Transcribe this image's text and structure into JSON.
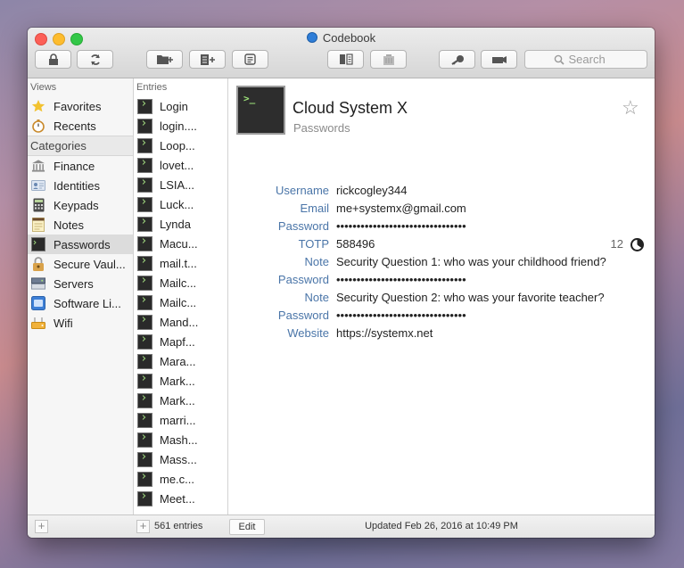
{
  "window": {
    "title": "Codebook"
  },
  "toolbar": {
    "buttons": [
      "lock-icon",
      "sync-icon",
      "add-folder-icon",
      "add-entry-icon",
      "note-icon",
      "split-view-icon",
      "trash-icon",
      "key-icon",
      "camera-icon"
    ],
    "search_placeholder": "Search"
  },
  "sidebar": {
    "views_header": "Views",
    "views": [
      {
        "label": "Favorites",
        "icon": "star-icon"
      },
      {
        "label": "Recents",
        "icon": "stopwatch-icon"
      }
    ],
    "categories_header": "Categories",
    "categories": [
      {
        "label": "Finance",
        "icon": "bank-icon"
      },
      {
        "label": "Identities",
        "icon": "id-card-icon"
      },
      {
        "label": "Keypads",
        "icon": "calculator-icon"
      },
      {
        "label": "Notes",
        "icon": "notepad-icon"
      },
      {
        "label": "Passwords",
        "icon": "terminal-icon",
        "selected": true
      },
      {
        "label": "Secure Vaul...",
        "icon": "padlock-icon"
      },
      {
        "label": "Servers",
        "icon": "server-icon"
      },
      {
        "label": "Software Li...",
        "icon": "software-icon"
      },
      {
        "label": "Wifi",
        "icon": "wifi-router-icon"
      }
    ]
  },
  "entries": {
    "header": "Entries",
    "items": [
      "Login",
      "login....",
      "Loop...",
      "lovet...",
      "LSIA...",
      "Luck...",
      "Lynda",
      "Macu...",
      "mail.t...",
      "Mailc...",
      "Mailc...",
      "Mand...",
      "Mapf...",
      "Mara...",
      "Mark...",
      "Mark...",
      "marri...",
      "Mash...",
      "Mass...",
      "me.c...",
      "Meet..."
    ]
  },
  "detail": {
    "title": "Cloud System X",
    "category": "Passwords",
    "icon": "terminal-icon",
    "fields": [
      {
        "label": "Username",
        "value": "rickcogley344"
      },
      {
        "label": "Email",
        "value": "me+systemx@gmail.com"
      },
      {
        "label": "Password",
        "value": "••••••••••••••••••••••••••••••••"
      },
      {
        "label": "TOTP",
        "value": "588496",
        "timer": "12"
      },
      {
        "label": "Note",
        "value": "Security Question 1: who was your childhood friend?"
      },
      {
        "label": "Password",
        "value": "••••••••••••••••••••••••••••••••"
      },
      {
        "label": "Note",
        "value": "Security Question 2: who was your favorite teacher?"
      },
      {
        "label": "Password",
        "value": "••••••••••••••••••••••••••••••••"
      },
      {
        "label": "Website",
        "value": "https://systemx.net"
      }
    ]
  },
  "footer": {
    "entry_count": "561 entries",
    "edit_label": "Edit",
    "updated": "Updated Feb 26, 2016 at 10:49 PM"
  }
}
